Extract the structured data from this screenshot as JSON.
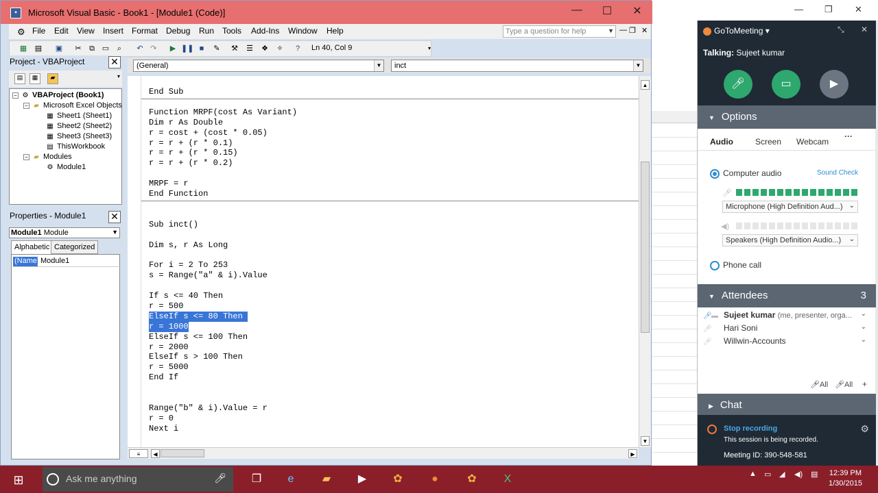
{
  "vba": {
    "title": "Microsoft Visual Basic - Book1 - [Module1 (Code)]",
    "menu": [
      "File",
      "Edit",
      "View",
      "Insert",
      "Format",
      "Debug",
      "Run",
      "Tools",
      "Add-Ins",
      "Window",
      "Help"
    ],
    "help_placeholder": "Type a question for help",
    "status": "Ln 40, Col 9",
    "project_title": "Project - VBAProject",
    "tree": {
      "root": "VBAProject (Book1)",
      "excel_objects": "Microsoft Excel Objects",
      "sheets": [
        "Sheet1 (Sheet1)",
        "Sheet2 (Sheet2)",
        "Sheet3 (Sheet3)"
      ],
      "workbook": "ThisWorkbook",
      "modules": "Modules",
      "module": "Module1"
    },
    "properties_title": "Properties - Module1",
    "props_object": "Module1",
    "props_object_type": "Module",
    "props_tabs": [
      "Alphabetic",
      "Categorized"
    ],
    "props_key": "(Name)",
    "props_value": "Module1",
    "combo_left": "(General)",
    "combo_right": "inct",
    "code_lines": [
      "End Sub",
      "",
      "Function MRPF(cost As Variant)",
      "Dim r As Double",
      "r = cost + (cost * 0.05)",
      "r = r + (r * 0.1)",
      "r = r + (r * 0.15)",
      "r = r + (r * 0.2)",
      "",
      "MRPF = r",
      "End Function",
      "",
      "",
      "Sub inct()",
      "",
      "Dim s, r As Long",
      "",
      "For i = 2 To 253",
      "s = Range(\"a\" & i).Value",
      "",
      "If s <= 40 Then",
      "r = 500",
      "ElseIf s <= 80 Then ",
      "r = 1000",
      "ElseIf s <= 100 Then",
      "r = 2000",
      "ElseIf s > 100 Then",
      "r = 5000",
      "End If",
      "",
      "",
      "Range(\"b\" & i).Value = r",
      "r = 0",
      "Next i"
    ],
    "selected_lines": [
      22,
      23
    ]
  },
  "gtm": {
    "brand": "GoToMeeting",
    "talking_label": "Talking:",
    "talking_name": "Sujeet kumar",
    "options": "Options",
    "audio_tabs": [
      "Audio",
      "Screen",
      "Webcam"
    ],
    "computer_audio": "Computer audio",
    "sound_check": "Sound Check",
    "microphone": "Microphone (High Definition Aud...)",
    "speakers": "Speakers (High Definition Audio...)",
    "phone_call": "Phone call",
    "attendees": "Attendees",
    "attendee_count": "3",
    "attendee_list": [
      {
        "name": "Sujeet kumar",
        "note": "(me, presenter, orga..."
      },
      {
        "name": "Hari Soni",
        "note": ""
      },
      {
        "name": "Willwin-Accounts",
        "note": ""
      }
    ],
    "mute_all": "All",
    "unmute_all": "All",
    "chat": "Chat",
    "stop_recording": "Stop recording",
    "session_note": "This session is being recorded.",
    "meeting_id": "Meeting ID: 390-548-581"
  },
  "taskbar": {
    "search_placeholder": "Ask me anything",
    "time": "12:39 PM",
    "date": "1/30/2015"
  },
  "colors": {
    "title_bar": "#e86f6f",
    "taskbar": "#8a1f2a",
    "selection": "#3875d7",
    "gtm_dark": "#1f2a35",
    "gtm_green": "#2ea86e"
  }
}
